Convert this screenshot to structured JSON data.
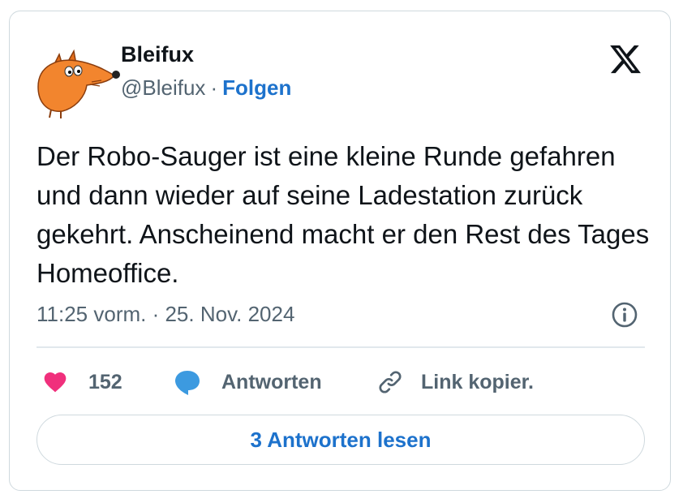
{
  "tweet": {
    "author_name": "Bleifux",
    "handle": "@Bleifux",
    "separator": "·",
    "follow_label": "Folgen",
    "text": "Der Robo-Sauger ist eine kleine Runde gefahren und dann wieder auf seine Ladestation zurück gekehrt. Anscheinend macht er den Rest des Tages Homeoffice.",
    "timestamp": "11:25 vorm. · 25. Nov. 2024"
  },
  "actions": {
    "like_count": "152",
    "reply_label": "Antworten",
    "copy_link_label": "Link kopier."
  },
  "read_replies_label": "3 Antworten lesen",
  "icons": {
    "avatar": "fox-avatar",
    "logo": "x-logo",
    "info": "info-icon",
    "like": "heart-icon",
    "reply": "speech-bubble-icon",
    "copy": "link-icon"
  },
  "colors": {
    "accent_blue": "#1d72cc",
    "heart_pink": "#f0307c",
    "bubble_blue": "#3c9ae0",
    "text_primary": "#0f1419",
    "text_secondary": "#536471",
    "border": "#cfd9de",
    "fox_orange": "#f2852e"
  }
}
